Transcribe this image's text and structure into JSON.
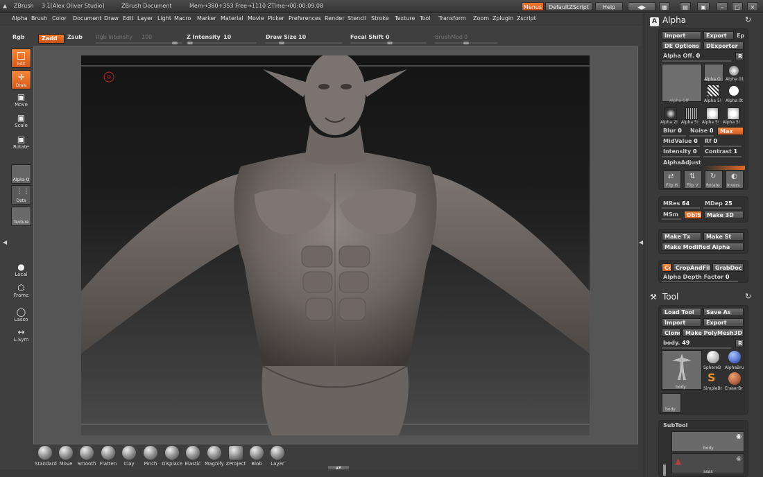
{
  "titlebar": {
    "app": "ZBrush",
    "version": "3.1[Alex Oliver Studio]",
    "document": "ZBrush Document",
    "stats": "Mem→380+353 Free→1110 ZTime→00:00:09.08",
    "menus_btn": "Menus",
    "script_btn": "DefaultZScript",
    "help_btn": "Help"
  },
  "menubar": [
    "Alpha",
    "Brush",
    "Color",
    "Document",
    "Draw",
    "Edit",
    "Layer",
    "Light",
    "Macro",
    "Marker",
    "Material",
    "Movie",
    "Picker",
    "Preferences",
    "Render",
    "Stencil",
    "Stroke",
    "Texture",
    "Tool",
    "Transform",
    "Zoom",
    "Zplugin",
    "Zscript"
  ],
  "toptool": {
    "rgb": "Rgb",
    "zadd": "Zadd",
    "zsub": "Zsub",
    "rgb_intensity_label": "Rgb Intensity",
    "rgb_intensity_value": "100",
    "z_intensity_label": "Z Intensity",
    "z_intensity_value": "10",
    "draw_size_label": "Draw Size",
    "draw_size_value": "10",
    "focal_shift_label": "Focal Shift",
    "focal_shift_value": "0",
    "brushmod_label": "BrushMod",
    "brushmod_value": "0"
  },
  "leftshelf": {
    "edit": "Edit",
    "draw": "Draw",
    "move": "Move",
    "scale": "Scale",
    "rotate": "Rotate",
    "alpha": "Alpha O",
    "dots": "Dots",
    "texture": "Texture",
    "local": "Local",
    "frame": "Frame",
    "lasso": "Lasso",
    "lsym": "L.Sym"
  },
  "brushes": [
    "Standard",
    "Move",
    "Smooth",
    "Flatten",
    "Clay",
    "Pinch",
    "Displace",
    "Elastic",
    "Magnify",
    "ZProject",
    "Blob",
    "Layer"
  ],
  "alpha_palette": {
    "title": "Alpha",
    "import": "Import",
    "export": "Export",
    "ep": "Ep",
    "de_options": "DE Options",
    "dexporter": "DExporter",
    "alpha_off_label": "Alpha Off.",
    "alpha_off_value": "0",
    "r": "R",
    "big_thumb_caption": "Alpha Off",
    "thumb_captions": [
      "Alpha O",
      "Alpha 01",
      "Alpha 5!",
      "Alpha 0t",
      "Alpha 2!",
      "Alpha 5!",
      "Alpha 5!",
      "Alpha 5!"
    ],
    "blur_label": "Blur",
    "blur_value": "0",
    "noise_label": "Noise",
    "noise_value": "0",
    "max": "Max",
    "midvalue_label": "MidValue",
    "midvalue_value": "0",
    "rf_label": "Rf",
    "rf_value": "0",
    "intensity_label": "Intensity",
    "intensity_value": "0",
    "contrast_label": "Contrast",
    "contrast_value": "1",
    "alphaadjust": "AlphaAdjust",
    "flip_h": "Flip H",
    "flip_v": "Flip V",
    "rotate": "Rotate",
    "invers": "Invers",
    "mres_label": "MRes",
    "mres_value": "64",
    "mdep_label": "MDep",
    "mdep_value": "25",
    "msm_label": "MSm",
    "dbls": "DblS",
    "make3d": "Make 3D",
    "make_tx": "Make Tx",
    "make_st": "Make St",
    "make_modified_alpha": "Make Modified Alpha",
    "cc": "Cc",
    "cropandfill": "CropAndFill",
    "grabdoc": "GrabDoc",
    "alpha_depth_label": "Alpha Depth Factor",
    "alpha_depth_value": "0"
  },
  "tool_palette": {
    "title": "Tool",
    "load_tool": "Load Tool",
    "save_as": "Save As",
    "import": "Import",
    "export": "Export",
    "clone": "Clone",
    "make_polymesh": "Make PolyMesh3D",
    "body_label": "body.",
    "body_value": "49",
    "r": "R",
    "main_caption": "body",
    "tools": [
      "SphereB",
      "AlphaBru",
      "SimpleBr",
      "EraserBr"
    ],
    "small_caption": "body",
    "subtool_title": "SubTool",
    "subtool_items": [
      "body",
      "asas"
    ]
  },
  "colors": {
    "accent": "#e06a24",
    "panel": "#3a3a3a",
    "canvas": "#141414"
  }
}
